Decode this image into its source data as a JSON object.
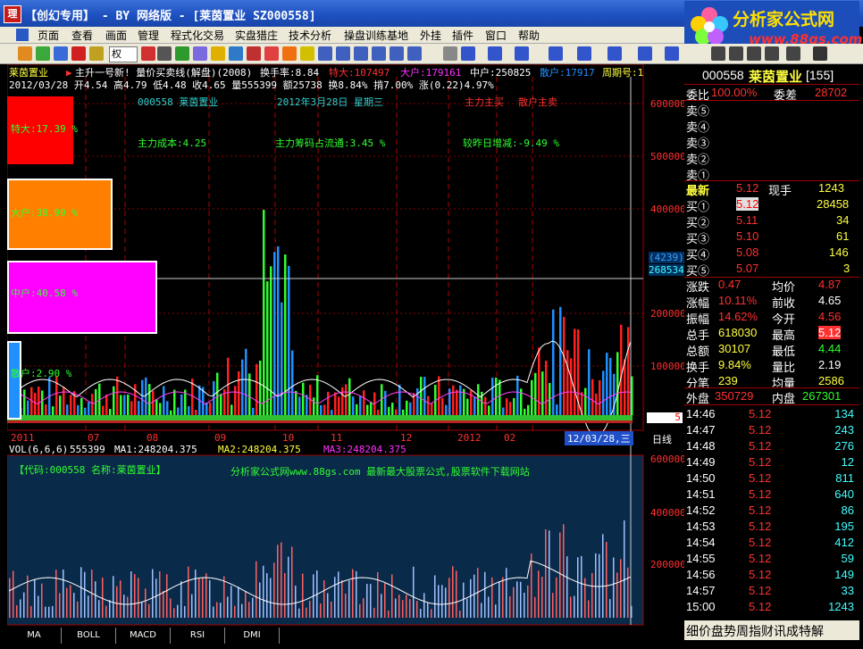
{
  "window": {
    "app_icon": "理",
    "title": "【创幻专用】 - BY 网络版 - [莱茵置业 SZ000558]"
  },
  "brand": {
    "name": "分析家公式网",
    "url": "www.88gs.com"
  },
  "menu": [
    "页面",
    "查看",
    "画面",
    "管理",
    "程式化交易",
    "实盘猎庄",
    "技术分析",
    "操盘训练基地",
    "外挂",
    "插件",
    "窗口",
    "帮助"
  ],
  "toolbar": {
    "combo_label": "权"
  },
  "chart_header": {
    "stock_name": "莱茵置业",
    "indicator_line": "主升一号新! 量价买卖线(解盘)(2008)",
    "turnover_label": "换手率:8.84",
    "tedai": "特大:107497",
    "dahu": "大户:179161",
    "zhonghu": "中户:250825",
    "sanhu": "散户:17917",
    "zhouqi": "周期号:1",
    "ohlc": "2012/03/28 开4.54 高4.79 低4.48 收4.65 量555399 额25738 换8.84% 掯7.00% 涨(0.22)4.97%"
  },
  "overlay": {
    "code_name": "000558  莱茵置业",
    "date_label": "2012年3月28日  星期三",
    "main_buy": "主力主买",
    "retail_buy": "散户主卖",
    "main_cost": "主力成本:4.25",
    "main_chip": "主力筹码占流通:3.45 %",
    "day_change": "较昨日增减:-9.49 %"
  },
  "boxes": {
    "tedai": "特大:17.39 %",
    "dahu": "大户:38.99 %",
    "zhonghu": "中户:40.58 %",
    "sanhu": "散户:2.90 %"
  },
  "y_axis_upper": [
    "600000",
    "500000",
    "400000",
    "200000",
    "100000"
  ],
  "y_axis_lower": [
    "600000",
    "400000",
    "200000"
  ],
  "cursor_readout": {
    "count": "(4239)",
    "value": "268534"
  },
  "marker_right": "5",
  "x_axis": {
    "labels": [
      "2011",
      "07",
      "08",
      "09",
      "10",
      "11",
      "12",
      "2012",
      "02"
    ],
    "cursor_date": "12/03/28,三",
    "period": "日线"
  },
  "vol_header": {
    "vol": "VOL(6,6,6)",
    "vol_value": "555399",
    "ma1": "MA1:248204.375",
    "ma2": "MA2:248204.375",
    "ma3": "MA3:248204.375"
  },
  "lower_panel": {
    "code_name": "【代码:000558 名称:莱茵置业】",
    "ad": "分析家公式网www.88gs.com 最新最大股票公式,股票软件下载网站"
  },
  "tabs": [
    "MA",
    "BOLL",
    "MACD",
    "RSI",
    "DMI"
  ],
  "quote_panel": {
    "code": "000558",
    "name": "莱茵置业",
    "num": "[155]",
    "weibi_label": "委比",
    "weibi": "100.00%",
    "weicha_label": "委差",
    "weicha": "28702",
    "sell_labels": [
      "卖⑤",
      "卖④",
      "卖③",
      "卖②",
      "卖①"
    ],
    "latest_label": "最新",
    "latest": "5.12",
    "xianshou_label": "现手",
    "xianshou": "1243",
    "buys": [
      {
        "label": "买①",
        "price": "5.12",
        "vol": "28458"
      },
      {
        "label": "买②",
        "price": "5.11",
        "vol": "34"
      },
      {
        "label": "买③",
        "price": "5.10",
        "vol": "61"
      },
      {
        "label": "买④",
        "price": "5.08",
        "vol": "146"
      },
      {
        "label": "买⑤",
        "price": "5.07",
        "vol": "3"
      }
    ],
    "stats": [
      {
        "l1": "涨跌",
        "v1": "0.47",
        "l2": "均价",
        "v2": "4.87"
      },
      {
        "l1": "涨幅",
        "v1": "10.11%",
        "l2": "前收",
        "v2": "4.65"
      },
      {
        "l1": "振幅",
        "v1": "14.62%",
        "l2": "今开",
        "v2": "4.56"
      },
      {
        "l1": "总手",
        "v1": "618030",
        "l2": "最高",
        "v2": "5.12"
      },
      {
        "l1": "总额",
        "v1": "30107",
        "l2": "最低",
        "v2": "4.44"
      },
      {
        "l1": "换手",
        "v1": "9.84%",
        "l2": "量比",
        "v2": "2.19"
      },
      {
        "l1": "分笔",
        "v1": "239",
        "l2": "均量",
        "v2": "2586"
      }
    ],
    "waipan_label": "外盘",
    "waipan": "350729",
    "neipan_label": "内盘",
    "neipan": "267301",
    "ticks": [
      {
        "t": "14:46",
        "p": "5.12",
        "v": "134"
      },
      {
        "t": "14:47",
        "p": "5.12",
        "v": "243"
      },
      {
        "t": "14:48",
        "p": "5.12",
        "v": "276"
      },
      {
        "t": "14:49",
        "p": "5.12",
        "v": "12"
      },
      {
        "t": "14:50",
        "p": "5.12",
        "v": "811"
      },
      {
        "t": "14:51",
        "p": "5.12",
        "v": "640"
      },
      {
        "t": "14:52",
        "p": "5.12",
        "v": "86"
      },
      {
        "t": "14:53",
        "p": "5.12",
        "v": "195"
      },
      {
        "t": "14:54",
        "p": "5.12",
        "v": "412"
      },
      {
        "t": "14:55",
        "p": "5.12",
        "v": "59"
      },
      {
        "t": "14:56",
        "p": "5.12",
        "v": "149"
      },
      {
        "t": "14:57",
        "p": "5.12",
        "v": "33"
      },
      {
        "t": "15:00",
        "p": "5.12",
        "v": "1243"
      }
    ],
    "bottom_tabs": "细价盘势周指财讯成特解"
  },
  "colors": {
    "up": "#ff3030",
    "down": "#30ff30",
    "blue": "#2090ff",
    "cyan": "#60ffff",
    "yellow": "#ffff40",
    "grid": "#a00000"
  }
}
